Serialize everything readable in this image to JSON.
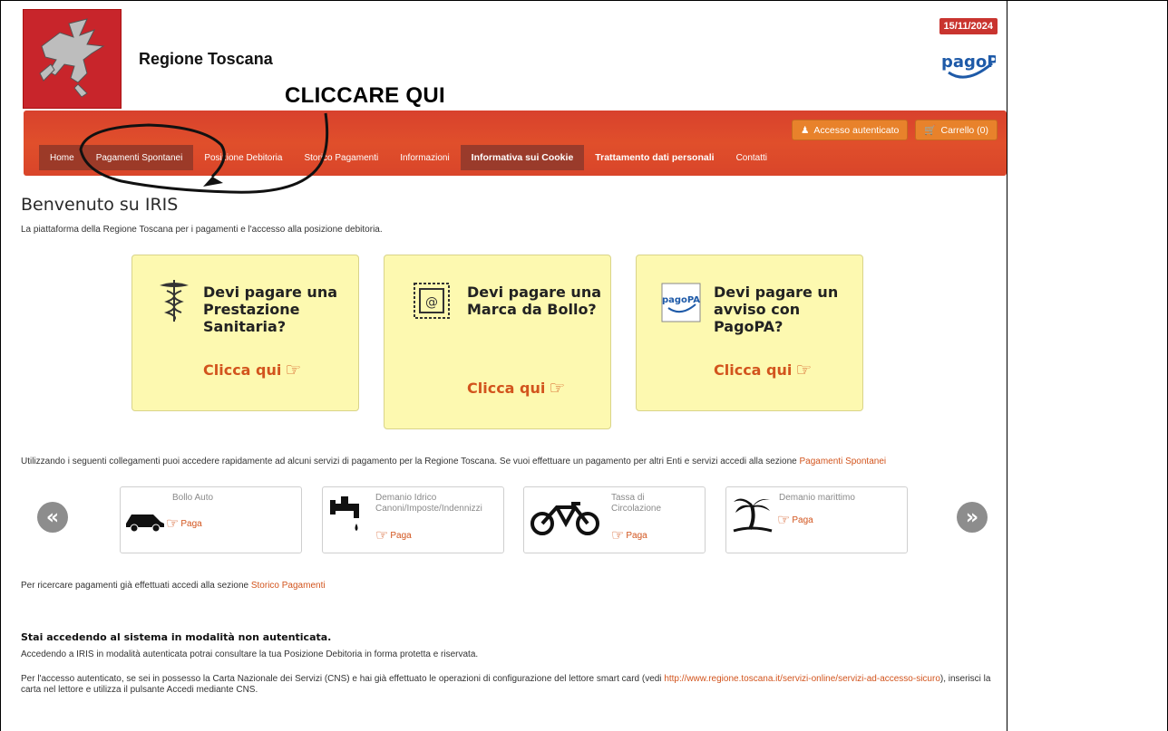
{
  "header": {
    "site_title": "Regione Toscana",
    "date_badge": "15/11/2024",
    "pagopa_logo": "pagoPA",
    "annotation": "CLICCARE QUI"
  },
  "nav_top": {
    "login_label": "Accesso autenticato",
    "cart_label": "Carrello (0)"
  },
  "nav": {
    "items": [
      {
        "label": "Home"
      },
      {
        "label": "Pagamenti Spontanei"
      },
      {
        "label": "Posizione Debitoria"
      },
      {
        "label": "Storico Pagamenti"
      },
      {
        "label": "Informazioni"
      },
      {
        "label": "Informativa sui Cookie"
      },
      {
        "label": "Trattamento dati personali"
      },
      {
        "label": "Contatti"
      }
    ]
  },
  "main": {
    "welcome": "Benvenuto su IRIS",
    "lead": "La piattaforma della Regione Toscana per i pagamenti e l'accesso alla posizione debitoria.",
    "cards": [
      {
        "title": "Devi pagare una Prestazione Sanitaria?",
        "link": "Clicca qui",
        "icon": "caduceus-icon"
      },
      {
        "title": "Devi pagare una Marca da Bollo?",
        "link": "Clicca qui",
        "icon": "stamp-icon"
      },
      {
        "title": "Devi pagare un avviso con PagoPA?",
        "link": "Clicca qui",
        "icon": "pagopa-icon"
      }
    ],
    "info_text": "Utilizzando i seguenti collegamenti puoi accedere rapidamente ad alcuni servizi di pagamento per la Regione Toscana. Se vuoi effettuare un pagamento per altri Enti e servizi accedi alla sezione ",
    "info_link": "Pagamenti Spontanei",
    "services": [
      {
        "name": "Bollo Auto",
        "pay": "Paga",
        "icon": "car-icon"
      },
      {
        "name": "Demanio Idrico Canoni/Imposte/Indennizzi",
        "pay": "Paga",
        "icon": "faucet-icon"
      },
      {
        "name": "Tassa di Circolazione",
        "pay": "Paga",
        "icon": "bicycle-icon"
      },
      {
        "name": "Demanio marittimo",
        "pay": "Paga",
        "icon": "palm-tree-icon"
      }
    ],
    "history_text": "Per ricercare pagamenti già effettuati accedi alla sezione ",
    "history_link": "Storico Pagamenti",
    "auth_heading": "Stai accedendo al sistema in modalità non autenticata.",
    "auth_text": "Accedendo a IRIS in modalità autenticata potrai consultare la tua Posizione Debitoria in forma protetta e riservata.",
    "cns_text_1": "Per l'accesso autenticato, se sei in possesso la Carta Nazionale dei Servizi (CNS) e hai già effettuato le operazioni di configurazione del lettore smart card (vedi ",
    "cns_link": "http://www.regione.toscana.it/servizi-online/servizi-ad-accesso-sicuro",
    "cns_text_2": "), inserisci la carta nel lettore e utilizza il pulsante Accedi mediante CNS."
  },
  "colors": {
    "brand_red": "#d8412d",
    "accent_orange": "#d2541d",
    "card_yellow": "#fdf9b0"
  }
}
